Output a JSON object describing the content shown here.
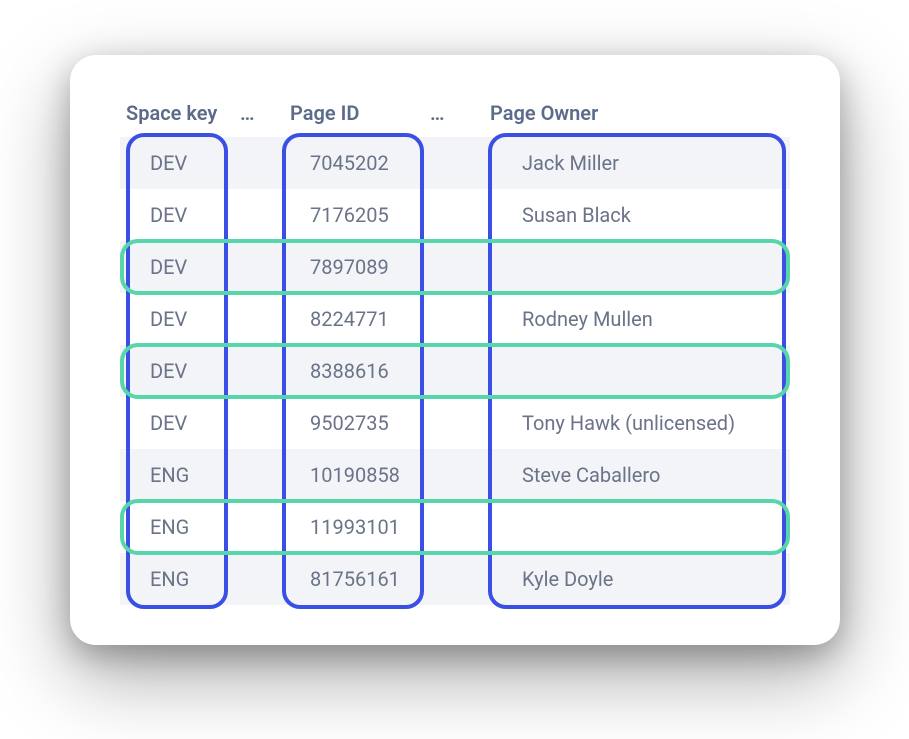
{
  "table": {
    "headers": {
      "space_key": "Space key",
      "gap1": "…",
      "page_id": "Page ID",
      "gap2": "…",
      "page_owner": "Page Owner"
    },
    "rows": [
      {
        "space_key": "DEV",
        "page_id": "7045202",
        "page_owner": "Jack Miller"
      },
      {
        "space_key": "DEV",
        "page_id": "7176205",
        "page_owner": "Susan Black"
      },
      {
        "space_key": "DEV",
        "page_id": "7897089",
        "page_owner": ""
      },
      {
        "space_key": "DEV",
        "page_id": "8224771",
        "page_owner": "Rodney Mullen"
      },
      {
        "space_key": "DEV",
        "page_id": "8388616",
        "page_owner": ""
      },
      {
        "space_key": "DEV",
        "page_id": "9502735",
        "page_owner": "Tony Hawk (unlicensed)"
      },
      {
        "space_key": "ENG",
        "page_id": "10190858",
        "page_owner": "Steve Caballero"
      },
      {
        "space_key": "ENG",
        "page_id": "11993101",
        "page_owner": ""
      },
      {
        "space_key": "ENG",
        "page_id": "81756161",
        "page_owner": "Kyle Doyle"
      }
    ]
  },
  "highlights": {
    "column_boxes": [
      {
        "name": "space-key-column"
      },
      {
        "name": "page-id-column"
      },
      {
        "name": "page-owner-column"
      }
    ],
    "row_boxes": [
      {
        "row_index": 2
      },
      {
        "row_index": 4
      },
      {
        "row_index": 7
      }
    ],
    "colors": {
      "column": "#3a4fe3",
      "row": "#57d6ac"
    }
  }
}
